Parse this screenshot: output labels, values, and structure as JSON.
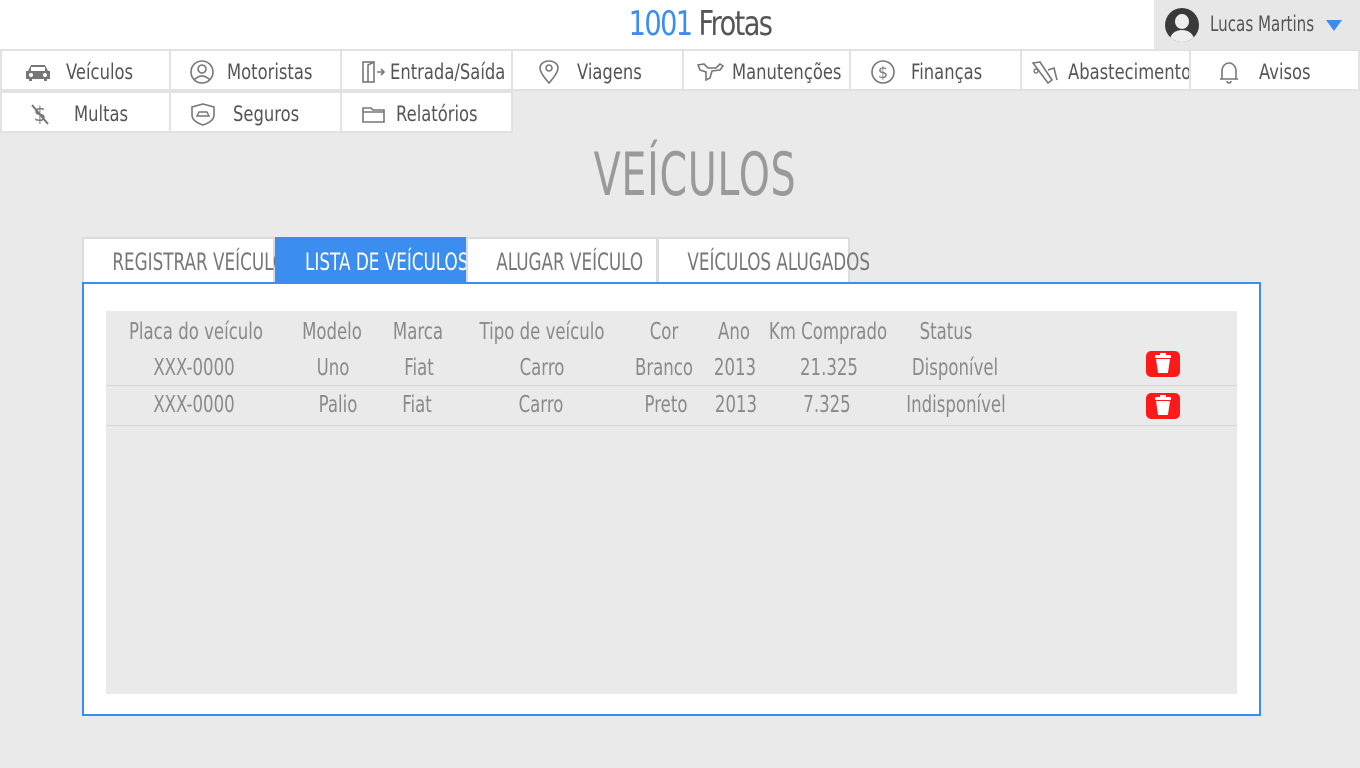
{
  "brand": {
    "number": "1001",
    "name": "Frotas"
  },
  "user": {
    "name": "Lucas Martins"
  },
  "nav": [
    {
      "label": "Veículos",
      "icon": "car-icon"
    },
    {
      "label": "Motoristas",
      "icon": "driver-icon"
    },
    {
      "label": "Entrada/Saída",
      "icon": "door-icon"
    },
    {
      "label": "Viagens",
      "icon": "map-pin-icon"
    },
    {
      "label": "Manutenções",
      "icon": "wrench-icon"
    },
    {
      "label": "Finanças",
      "icon": "dollar-icon"
    },
    {
      "label": "Abastecimento",
      "icon": "fuel-pump-icon"
    },
    {
      "label": "Avisos",
      "icon": "bell-icon"
    },
    {
      "label": "Multas",
      "icon": "dollar-slash-icon"
    },
    {
      "label": "Seguros",
      "icon": "insurance-icon"
    },
    {
      "label": "Relatórios",
      "icon": "folder-icon"
    }
  ],
  "page_title": "VEÍCULOS",
  "tabs": [
    {
      "label": "REGISTRAR VEÍCULO",
      "active": false
    },
    {
      "label": "LISTA DE VEÍCULOS",
      "active": true
    },
    {
      "label": "ALUGAR VEÍCULO",
      "active": false
    },
    {
      "label": "VEÍCULOS ALUGADOS",
      "active": false
    }
  ],
  "table": {
    "headers": [
      "Placa do veículo",
      "Modelo",
      "Marca",
      "Tipo de veículo",
      "Cor",
      "Ano",
      "Km Comprado",
      "Status"
    ],
    "rows": [
      [
        "XXX-0000",
        "Uno",
        "Fiat",
        "Carro",
        "Branco",
        "2013",
        "21.325",
        "Disponível"
      ],
      [
        "XXX-0000",
        "Palio",
        "Fiat",
        "Carro",
        "Preto",
        "2013",
        "7.325",
        "Indisponível"
      ]
    ]
  },
  "colors": {
    "accent": "#3b8ef0",
    "delete": "#ff1a1a",
    "background": "#eaeaea"
  }
}
